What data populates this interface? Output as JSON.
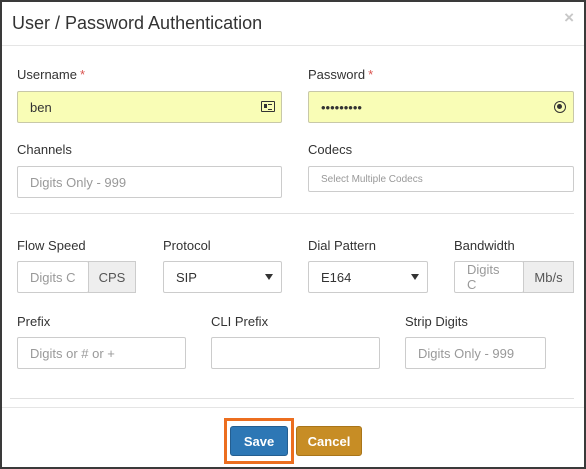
{
  "dialog": {
    "title": "User / Password Authentication",
    "close_glyph": "×"
  },
  "fields": {
    "username": {
      "label": "Username",
      "required_mark": "*",
      "value": "ben",
      "icon": "id-card-icon"
    },
    "password": {
      "label": "Password",
      "required_mark": "*",
      "value": "•••••••••",
      "icon": "key-icon"
    },
    "channels": {
      "label": "Channels",
      "placeholder": "Digits Only - 999"
    },
    "codecs": {
      "label": "Codecs",
      "placeholder": "Select Multiple Codecs"
    },
    "flow_speed": {
      "label": "Flow Speed",
      "placeholder": "Digits C",
      "addon": "CPS"
    },
    "protocol": {
      "label": "Protocol",
      "value": "SIP"
    },
    "dial_pattern": {
      "label": "Dial Pattern",
      "value": "E164"
    },
    "bandwidth": {
      "label": "Bandwidth",
      "placeholder": "Digits C",
      "addon": "Mb/s"
    },
    "prefix": {
      "label": "Prefix",
      "placeholder": "Digits or # or +"
    },
    "cli_prefix": {
      "label": "CLI Prefix",
      "placeholder": ""
    },
    "strip_digits": {
      "label": "Strip Digits",
      "placeholder": "Digits Only - 999"
    }
  },
  "footer": {
    "save_label": "Save",
    "cancel_label": "Cancel"
  },
  "colors": {
    "autofill_yellow": "#f9fdb6",
    "save_blue": "#2d77b5",
    "cancel_gold": "#c78d25",
    "highlight_orange": "#ec6e1f",
    "required_red": "#d9534f"
  }
}
